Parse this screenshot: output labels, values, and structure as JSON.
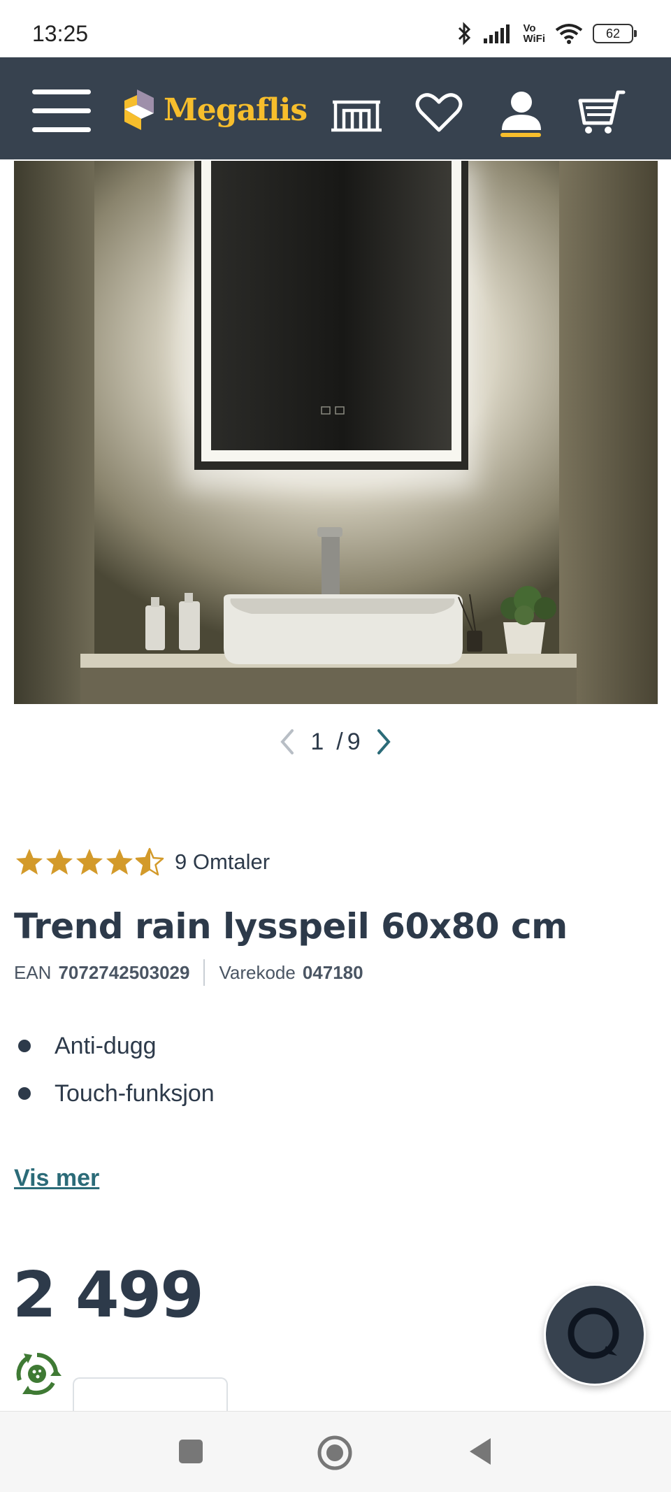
{
  "status_bar": {
    "time": "13:25",
    "battery": "62",
    "network": "Vo\nWiFi",
    "icons": [
      "bluetooth-icon",
      "signal-icon",
      "vowifi-icon",
      "wifi-icon",
      "battery-icon"
    ]
  },
  "header": {
    "brand": "Megaflis",
    "icons": [
      "menu-icon",
      "showroom-icon",
      "heart-icon",
      "account-icon",
      "cart-icon"
    ],
    "colors": {
      "background": "#37424f",
      "accent": "#f7be2c"
    }
  },
  "gallery": {
    "current": "1",
    "separator": "/",
    "total": "9"
  },
  "product": {
    "rating": 4.5,
    "reviews_label": "9 Omtaler",
    "title": "Trend rain lysspeil 60x80 cm",
    "ean_label": "EAN",
    "ean": "7072742503029",
    "code_label": "Varekode",
    "code": "047180",
    "features": [
      "Anti-dugg",
      "Touch-funksjon"
    ],
    "more_link": "Vis mer",
    "price": "2 499"
  },
  "nav": {
    "icons": [
      "recents-icon",
      "home-icon",
      "back-icon"
    ]
  }
}
